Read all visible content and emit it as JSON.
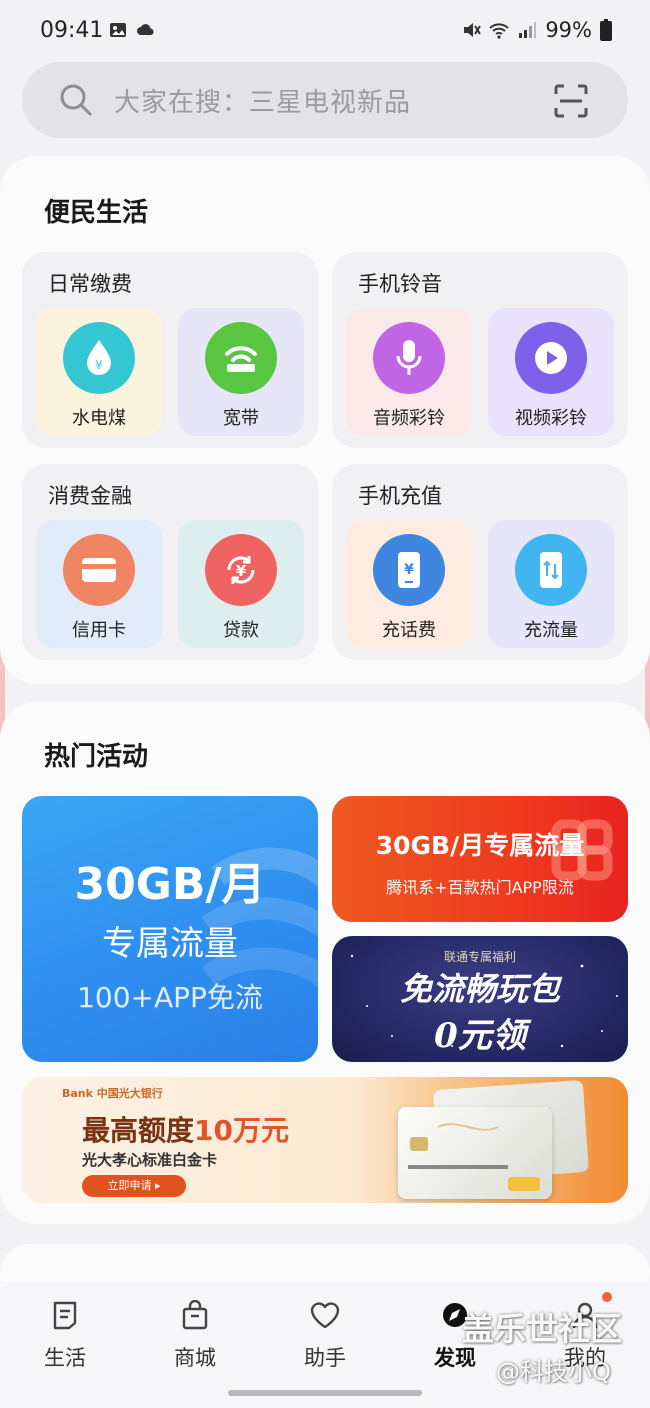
{
  "status_bar": {
    "time": "09:41",
    "battery": "99%"
  },
  "search": {
    "placeholder": "大家在搜：三星电视新品"
  },
  "convenience": {
    "title": "便民生活",
    "groups": [
      {
        "title": "日常缴费",
        "items": [
          {
            "label": "水电煤",
            "icon": "water-drop-icon"
          },
          {
            "label": "宽带",
            "icon": "router-icon"
          }
        ]
      },
      {
        "title": "手机铃音",
        "items": [
          {
            "label": "音频彩铃",
            "icon": "microphone-icon"
          },
          {
            "label": "视频彩铃",
            "icon": "play-icon"
          }
        ]
      },
      {
        "title": "消费金融",
        "items": [
          {
            "label": "信用卡",
            "icon": "credit-card-icon"
          },
          {
            "label": "贷款",
            "icon": "yuan-cycle-icon"
          }
        ]
      },
      {
        "title": "手机充值",
        "items": [
          {
            "label": "充话费",
            "icon": "phone-yuan-icon"
          },
          {
            "label": "充流量",
            "icon": "phone-data-icon"
          }
        ]
      }
    ]
  },
  "activities": {
    "title": "热门活动",
    "banner_big": {
      "line1": "30GB/月",
      "line2": "专属流量",
      "line3": "100+APP免流"
    },
    "banner_red": {
      "line1": "30GB/月专属流量",
      "line2": "腾讯系+百款热门APP限流"
    },
    "banner_navy": {
      "line0": "联通专属福利",
      "line1": "免流畅玩包",
      "line2": "0元领"
    },
    "banner_bank": {
      "logo": "Bank 中国光大银行",
      "line1_pre": "最高额度",
      "line1_hl": "10万元",
      "line2": "光大孝心标准白金卡",
      "button": "立即申请 ▸"
    }
  },
  "bottom_nav": [
    {
      "label": "生活",
      "icon": "life-icon"
    },
    {
      "label": "商城",
      "icon": "shop-bag-icon"
    },
    {
      "label": "助手",
      "icon": "heart-icon"
    },
    {
      "label": "发现",
      "icon": "discover-icon"
    },
    {
      "label": "我的",
      "icon": "person-icon"
    }
  ],
  "watermark": {
    "line1": "盖乐世社区",
    "line2": "@科技小Q"
  },
  "colors": {
    "accent": "#2f8ff0",
    "red_banner": "#ee3b1f",
    "navy_banner": "#252965",
    "bank_orange": "#e2521c"
  }
}
